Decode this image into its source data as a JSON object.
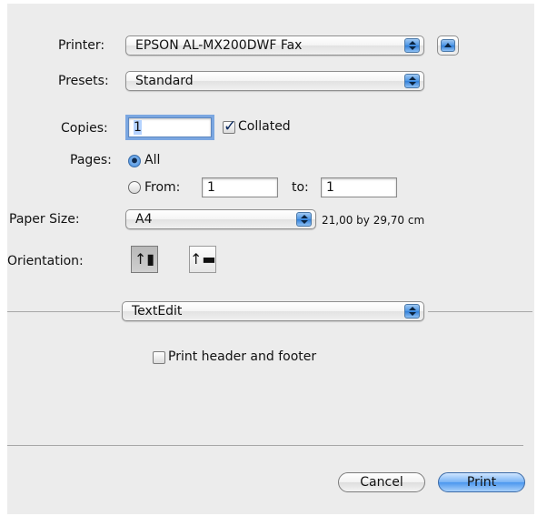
{
  "printer": {
    "label": "Printer:",
    "value": "EPSON AL-MX200DWF Fax"
  },
  "presets": {
    "label": "Presets:",
    "value": "Standard"
  },
  "copies": {
    "label": "Copies:",
    "value": "1",
    "collated_label": "Collated",
    "collated_checked": true
  },
  "pages": {
    "label": "Pages:",
    "all_label": "All",
    "from_label": "From:",
    "from_value": "1",
    "to_label": "to:",
    "to_value": "1",
    "selected": "All"
  },
  "paper_size": {
    "label": "Paper Size:",
    "value": "A4",
    "dimensions": "21,00 by 29,70 cm"
  },
  "orientation": {
    "label": "Orientation:",
    "selected": "portrait"
  },
  "app_section": {
    "value": "TextEdit"
  },
  "print_header_footer": {
    "label": "Print header and footer",
    "checked": false
  },
  "buttons": {
    "cancel": "Cancel",
    "print": "Print"
  }
}
